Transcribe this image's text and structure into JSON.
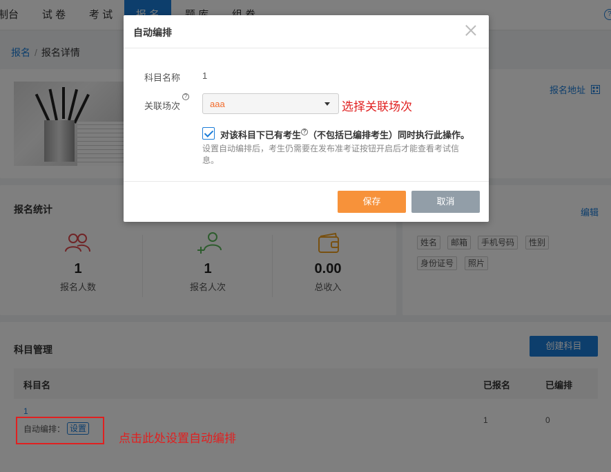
{
  "nav": {
    "items": [
      "制台",
      "试 卷",
      "考 试",
      "报 名",
      "题 库",
      "组 卷"
    ],
    "help": "?"
  },
  "breadcrumb": {
    "root": "报名",
    "separator": "/",
    "current": "报名详情"
  },
  "info_card": {
    "signup_url_link": "报名地址"
  },
  "stats_card": {
    "title": "报名统计",
    "stats": [
      {
        "value": "1",
        "label": "报名人数",
        "icon": "users-icon"
      },
      {
        "value": "1",
        "label": "报名人次",
        "icon": "user-add-icon"
      },
      {
        "value": "0.00",
        "label": "总收入",
        "icon": "wallet-icon"
      }
    ]
  },
  "fields_card": {
    "edit_link": "编辑",
    "tags": [
      "姓名",
      "邮箱",
      "手机号码",
      "性别",
      "身份证号",
      "照片"
    ]
  },
  "subjects_card": {
    "title": "科目管理",
    "create_button": "创建科目",
    "columns": [
      "科目名",
      "已报名",
      "已编排"
    ],
    "rows": [
      {
        "name": "1",
        "auto_label": "自动编排：",
        "auto_button": "设置",
        "registered": "1",
        "arranged": "0"
      }
    ]
  },
  "modal": {
    "title": "自动编排",
    "subject_label": "科目名称",
    "subject_value": "1",
    "session_label": "关联场次",
    "session_value": "aaa",
    "checkbox_label": "对该科目下已有考生",
    "checkbox_label_tail": "（不包括已编排考生）同时执行此操作。",
    "note": "设置自动编排后，考生仍需要在发布准考证按钮开启后才能查看考试信息。",
    "save": "保存",
    "cancel": "取消"
  },
  "annotations": {
    "select_hint": "选择关联场次",
    "click_hint": "点击此处设置自动编排"
  },
  "colors": {
    "primary": "#1a7cd8",
    "save": "#f7923a",
    "cancel": "#929ea8",
    "annotation": "#e02020",
    "stat_icon_red": "#e0484c",
    "stat_icon_green": "#5bb85b",
    "stat_icon_orange": "#f0a020"
  }
}
